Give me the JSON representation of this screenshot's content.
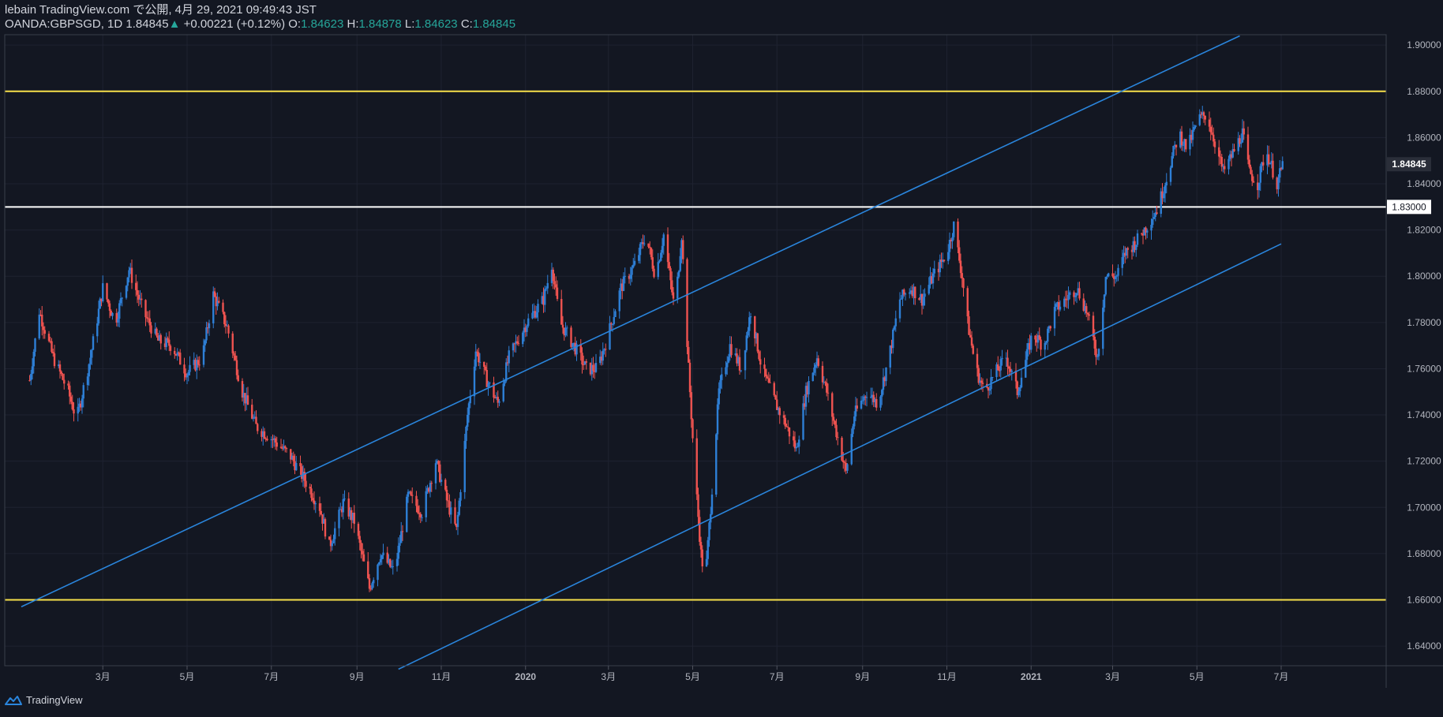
{
  "header": {
    "publish_line": "lebain TradingView.com で公開, 4月 29, 2021 09:49:43 JST",
    "symbol": "OANDA:GBPSGD, 1D",
    "last": "1.84845",
    "change_arrow": "▲",
    "change": "+0.00221 (+0.12%)",
    "o_label": "O:",
    "o_value": "1.84623",
    "h_label": "H:",
    "h_value": "1.84878",
    "l_label": "L:",
    "l_value": "1.84623",
    "c_label": "C:",
    "c_value": "1.84845"
  },
  "footer": {
    "brand": "TradingView"
  },
  "colors": {
    "background": "#131722",
    "up": "#2e7fd6",
    "down": "#ef5350",
    "support_resistance": "#f7e04b",
    "white_level": "#ffffff",
    "channel": "#2a85dc",
    "axis_text": "#b2b5be",
    "grid": "#1e2230"
  },
  "chart_data": {
    "type": "candlestick",
    "symbol": "OANDA:GBPSGD",
    "interval": "1D",
    "x_ticks": [
      "3月",
      "5月",
      "7月",
      "9月",
      "11月",
      "2020",
      "3月",
      "5月",
      "7月",
      "9月",
      "11月",
      "2021",
      "3月",
      "5月",
      "7月"
    ],
    "y_ticks": [
      "1.90000",
      "1.88000",
      "1.86000",
      "1.84000",
      "1.82000",
      "1.80000",
      "1.78000",
      "1.76000",
      "1.74000",
      "1.72000",
      "1.70000",
      "1.68000",
      "1.66000",
      "1.64000"
    ],
    "ylim": [
      1.6315,
      1.9045
    ],
    "last_price_label": "1.84845",
    "horizontal_levels": [
      {
        "price": 1.88,
        "color": "yellow"
      },
      {
        "price": 1.83,
        "color": "white",
        "label": "1.83000"
      },
      {
        "price": 1.66,
        "color": "yellow"
      }
    ],
    "trend_lines": [
      {
        "from": [
          "2019-01",
          1.657
        ],
        "to": [
          "2021-06",
          1.904
        ]
      },
      {
        "from": [
          "2019-10",
          1.63
        ],
        "to": [
          "2021-07",
          1.814
        ]
      }
    ],
    "close_path": [
      [
        "2019-01-07",
        1.755
      ],
      [
        "2019-01-14",
        1.785
      ],
      [
        "2019-01-24",
        1.765
      ],
      [
        "2019-02-04",
        1.75
      ],
      [
        "2019-02-10",
        1.738
      ],
      [
        "2019-02-20",
        1.765
      ],
      [
        "2019-03-01",
        1.795
      ],
      [
        "2019-03-10",
        1.78
      ],
      [
        "2019-03-20",
        1.803
      ],
      [
        "2019-03-30",
        1.785
      ],
      [
        "2019-04-10",
        1.772
      ],
      [
        "2019-04-20",
        1.77
      ],
      [
        "2019-05-01",
        1.758
      ],
      [
        "2019-05-12",
        1.765
      ],
      [
        "2019-05-20",
        1.792
      ],
      [
        "2019-05-30",
        1.778
      ],
      [
        "2019-06-10",
        1.75
      ],
      [
        "2019-06-20",
        1.735
      ],
      [
        "2019-07-01",
        1.73
      ],
      [
        "2019-07-15",
        1.722
      ],
      [
        "2019-07-25",
        1.712
      ],
      [
        "2019-08-05",
        1.7
      ],
      [
        "2019-08-12",
        1.683
      ],
      [
        "2019-08-22",
        1.702
      ],
      [
        "2019-08-30",
        1.694
      ],
      [
        "2019-09-10",
        1.665
      ],
      [
        "2019-09-18",
        1.68
      ],
      [
        "2019-09-28",
        1.672
      ],
      [
        "2019-10-08",
        1.705
      ],
      [
        "2019-10-18",
        1.698
      ],
      [
        "2019-10-28",
        1.72
      ],
      [
        "2019-11-05",
        1.703
      ],
      [
        "2019-11-12",
        1.69
      ],
      [
        "2019-11-20",
        1.74
      ],
      [
        "2019-11-26",
        1.768
      ],
      [
        "2019-12-04",
        1.755
      ],
      [
        "2019-12-12",
        1.745
      ],
      [
        "2019-12-20",
        1.765
      ],
      [
        "2020-01-02",
        1.78
      ],
      [
        "2020-01-14",
        1.79
      ],
      [
        "2020-01-20",
        1.805
      ],
      [
        "2020-01-26",
        1.78
      ],
      [
        "2020-02-05",
        1.77
      ],
      [
        "2020-02-14",
        1.76
      ],
      [
        "2020-02-22",
        1.76
      ],
      [
        "2020-03-01",
        1.775
      ],
      [
        "2020-03-10",
        1.795
      ],
      [
        "2020-03-20",
        1.805
      ],
      [
        "2020-03-28",
        1.818
      ],
      [
        "2020-04-04",
        1.8
      ],
      [
        "2020-04-10",
        1.818
      ],
      [
        "2020-04-18",
        1.785
      ],
      [
        "2020-04-23",
        1.818
      ],
      [
        "2020-04-28",
        1.76
      ],
      [
        "2020-05-02",
        1.72
      ],
      [
        "2020-05-07",
        1.68
      ],
      [
        "2020-05-10",
        1.668
      ],
      [
        "2020-05-14",
        1.7
      ],
      [
        "2020-05-20",
        1.75
      ],
      [
        "2020-05-28",
        1.77
      ],
      [
        "2020-06-05",
        1.76
      ],
      [
        "2020-06-12",
        1.785
      ],
      [
        "2020-06-20",
        1.76
      ],
      [
        "2020-06-30",
        1.745
      ],
      [
        "2020-07-08",
        1.735
      ],
      [
        "2020-07-15",
        1.725
      ],
      [
        "2020-07-22",
        1.75
      ],
      [
        "2020-07-30",
        1.765
      ],
      [
        "2020-08-06",
        1.75
      ],
      [
        "2020-08-14",
        1.73
      ],
      [
        "2020-08-20",
        1.715
      ],
      [
        "2020-08-26",
        1.74
      ],
      [
        "2020-09-04",
        1.75
      ],
      [
        "2020-09-12",
        1.745
      ],
      [
        "2020-09-20",
        1.765
      ],
      [
        "2020-09-28",
        1.79
      ],
      [
        "2020-10-06",
        1.795
      ],
      [
        "2020-10-14",
        1.79
      ],
      [
        "2020-10-22",
        1.8
      ],
      [
        "2020-11-01",
        1.81
      ],
      [
        "2020-11-06",
        1.822
      ],
      [
        "2020-11-12",
        1.8
      ],
      [
        "2020-11-16",
        1.78
      ],
      [
        "2020-11-22",
        1.76
      ],
      [
        "2020-11-28",
        1.75
      ],
      [
        "2020-12-06",
        1.758
      ],
      [
        "2020-12-14",
        1.765
      ],
      [
        "2020-12-22",
        1.75
      ],
      [
        "2021-01-02",
        1.775
      ],
      [
        "2021-01-10",
        1.77
      ],
      [
        "2021-01-18",
        1.785
      ],
      [
        "2021-01-26",
        1.79
      ],
      [
        "2021-02-03",
        1.795
      ],
      [
        "2021-02-10",
        1.785
      ],
      [
        "2021-02-18",
        1.765
      ],
      [
        "2021-02-24",
        1.8
      ],
      [
        "2021-03-04",
        1.8
      ],
      [
        "2021-03-10",
        1.81
      ],
      [
        "2021-03-18",
        1.815
      ],
      [
        "2021-03-26",
        1.822
      ],
      [
        "2021-04-03",
        1.83
      ],
      [
        "2021-04-10",
        1.845
      ],
      [
        "2021-04-18",
        1.862
      ],
      [
        "2021-04-24",
        1.855
      ],
      [
        "2021-05-02",
        1.868
      ],
      [
        "2021-05-08",
        1.87
      ],
      [
        "2021-05-14",
        1.858
      ],
      [
        "2021-05-20",
        1.845
      ],
      [
        "2021-05-26",
        1.852
      ],
      [
        "2021-06-03",
        1.862
      ],
      [
        "2021-06-08",
        1.845
      ],
      [
        "2021-06-14",
        1.84
      ],
      [
        "2021-06-20",
        1.855
      ],
      [
        "2021-06-28",
        1.84
      ],
      [
        "2021-07-02",
        1.848
      ]
    ]
  }
}
